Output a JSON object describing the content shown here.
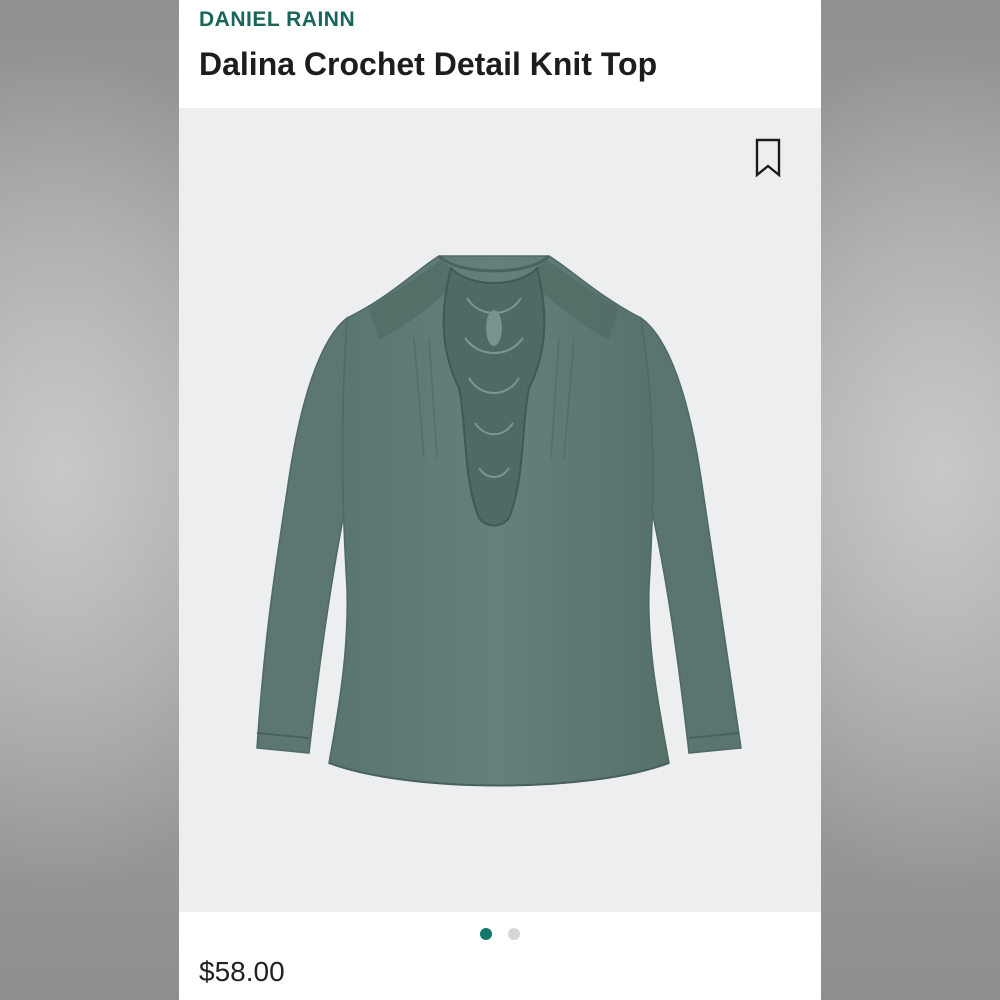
{
  "product": {
    "brand": "DANIEL RAINN",
    "title": "Dalina Crochet Detail Knit Top",
    "price": "$58.00"
  },
  "gallery": {
    "image_subject": "sage green long-sleeve knit top with crochet lace bib",
    "image_count": 2,
    "active_index": 0
  },
  "icons": {
    "bookmark": "bookmark-icon"
  },
  "colors": {
    "brand_accent": "#18665a",
    "active_dot": "#117867",
    "inactive_dot": "#d5d6d8",
    "photo_bg": "#eceef0",
    "garment": "#5f7a74"
  }
}
